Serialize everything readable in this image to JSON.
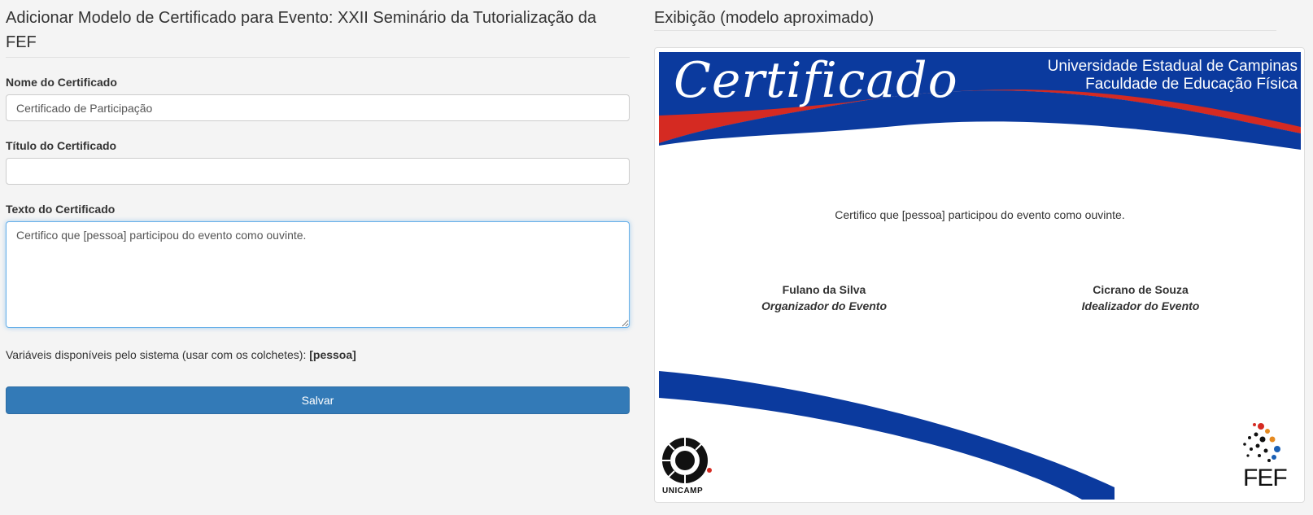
{
  "form": {
    "title": "Adicionar Modelo de Certificado para Evento: XXII Seminário da Tutorialização da FEF",
    "name_label": "Nome do Certificado",
    "name_value": "Certificado de Participação",
    "title_label": "Título do Certificado",
    "title_value": "",
    "text_label": "Texto do Certificado",
    "text_value": "Certifico que [pessoa] participou do evento como ouvinte.",
    "variables_text": "Variáveis disponíveis pelo sistema (usar com os colchetes):",
    "variables_value": "[pessoa]",
    "save_label": "Salvar"
  },
  "preview": {
    "title": "Exibição (modelo aproximado)",
    "heading": "Certificado",
    "university": "Universidade Estadual de Campinas",
    "faculty": "Faculdade de Educação Física",
    "body": "Certifico que [pessoa] participou do evento como ouvinte.",
    "signers": [
      {
        "name": "Fulano da Silva",
        "role": "Organizador do Evento"
      },
      {
        "name": "Cicrano de Souza",
        "role": "Idealizador do Evento"
      }
    ],
    "logo_left": "UNICAMP",
    "logo_right": "FEF"
  },
  "colors": {
    "primary_button": "#337ab7",
    "banner_blue": "#0b3a9e",
    "banner_red": "#d52a22"
  }
}
